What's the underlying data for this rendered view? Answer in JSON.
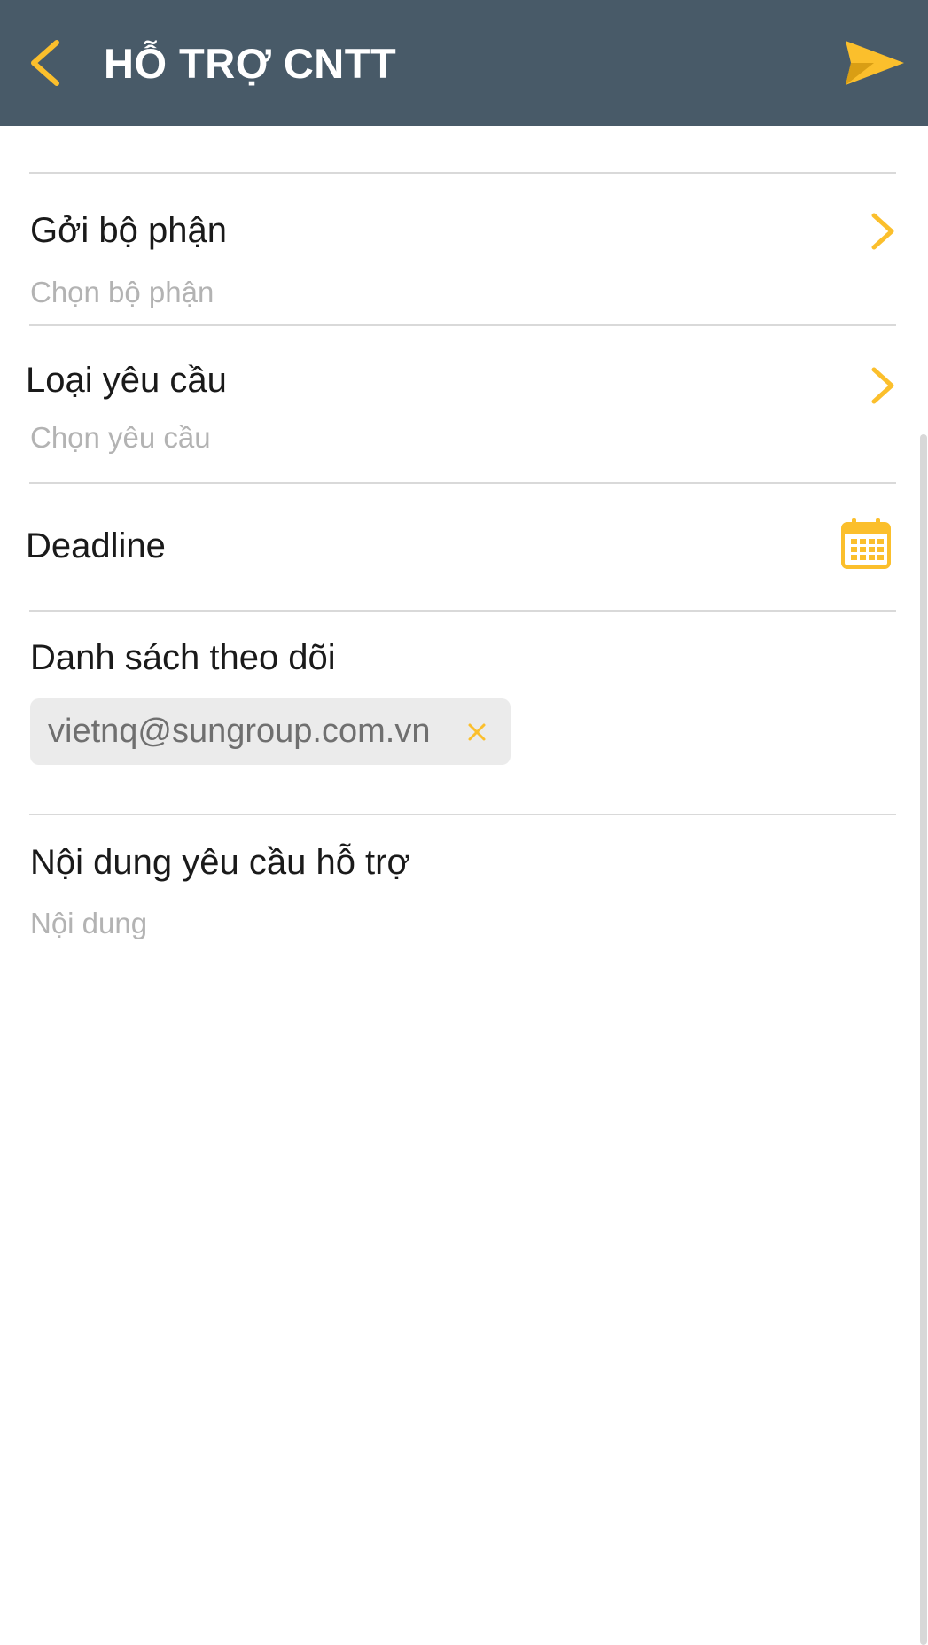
{
  "header": {
    "title": "HỖ TRỢ CNTT",
    "back_icon": "chevron-left-icon",
    "send_icon": "paper-plane-send-icon",
    "background_color": "#485a68",
    "accent_color": "#fbbf2c"
  },
  "form": {
    "department": {
      "label": "Gởi bộ phận",
      "placeholder": "Chọn bộ phận",
      "icon": "chevron-right-icon"
    },
    "request_type": {
      "label": "Loại yêu cầu",
      "placeholder": "Chọn yêu cầu",
      "icon": "chevron-right-icon"
    },
    "deadline": {
      "label": "Deadline",
      "icon": "calendar-icon"
    },
    "watch_list": {
      "label": "Danh sách theo dõi",
      "chips": [
        {
          "email": "vietnq@sungroup.com.vn",
          "remove_icon": "close-icon"
        }
      ]
    },
    "content": {
      "label": "Nội dung yêu cầu hỗ trợ",
      "placeholder": "Nội dung"
    }
  }
}
